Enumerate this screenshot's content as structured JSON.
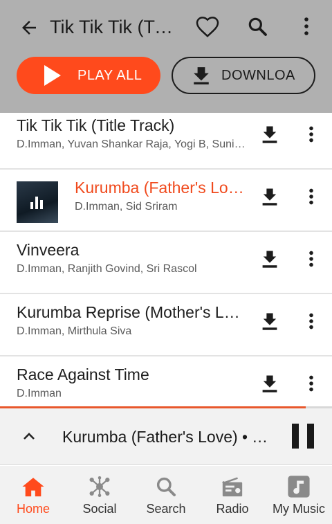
{
  "header": {
    "title": "Tik Tik Tik (Title Track)",
    "play_all_label": "PLAY ALL",
    "download_label": "DOWNLOA"
  },
  "tracks": [
    {
      "title": "Tik Tik Tik (Title Track)",
      "artists": "D.Imman, Yuvan Shankar Raja, Yogi B, Sunitha Sarathy",
      "playing": false,
      "has_thumb": false
    },
    {
      "title": "Kurumba (Father's Love)",
      "artists": "D.Imman, Sid Sriram",
      "playing": true,
      "has_thumb": true
    },
    {
      "title": "Vinveera",
      "artists": "D.Imman, Ranjith Govind, Sri Rascol",
      "playing": false,
      "has_thumb": false
    },
    {
      "title": "Kurumba Reprise (Mother's Love)",
      "artists": "D.Imman, Mirthula Siva",
      "playing": false,
      "has_thumb": false
    },
    {
      "title": "Race Against Time",
      "artists": "D.Imman",
      "playing": false,
      "has_thumb": false
    }
  ],
  "player": {
    "now_playing": "Kurumba (Father's Love) • Tik Tik Tik",
    "progress": 0.92
  },
  "nav": [
    {
      "label": "Home",
      "icon": "home-icon",
      "active": true
    },
    {
      "label": "Social",
      "icon": "social-icon",
      "active": false
    },
    {
      "label": "Search",
      "icon": "search-icon",
      "active": false
    },
    {
      "label": "Radio",
      "icon": "radio-icon",
      "active": false
    },
    {
      "label": "My Music",
      "icon": "music-note-icon",
      "active": false
    }
  ],
  "colors": {
    "accent": "#ff4a1c",
    "header_bg": "#b0b0b0",
    "playing_text": "#f04a1d"
  }
}
